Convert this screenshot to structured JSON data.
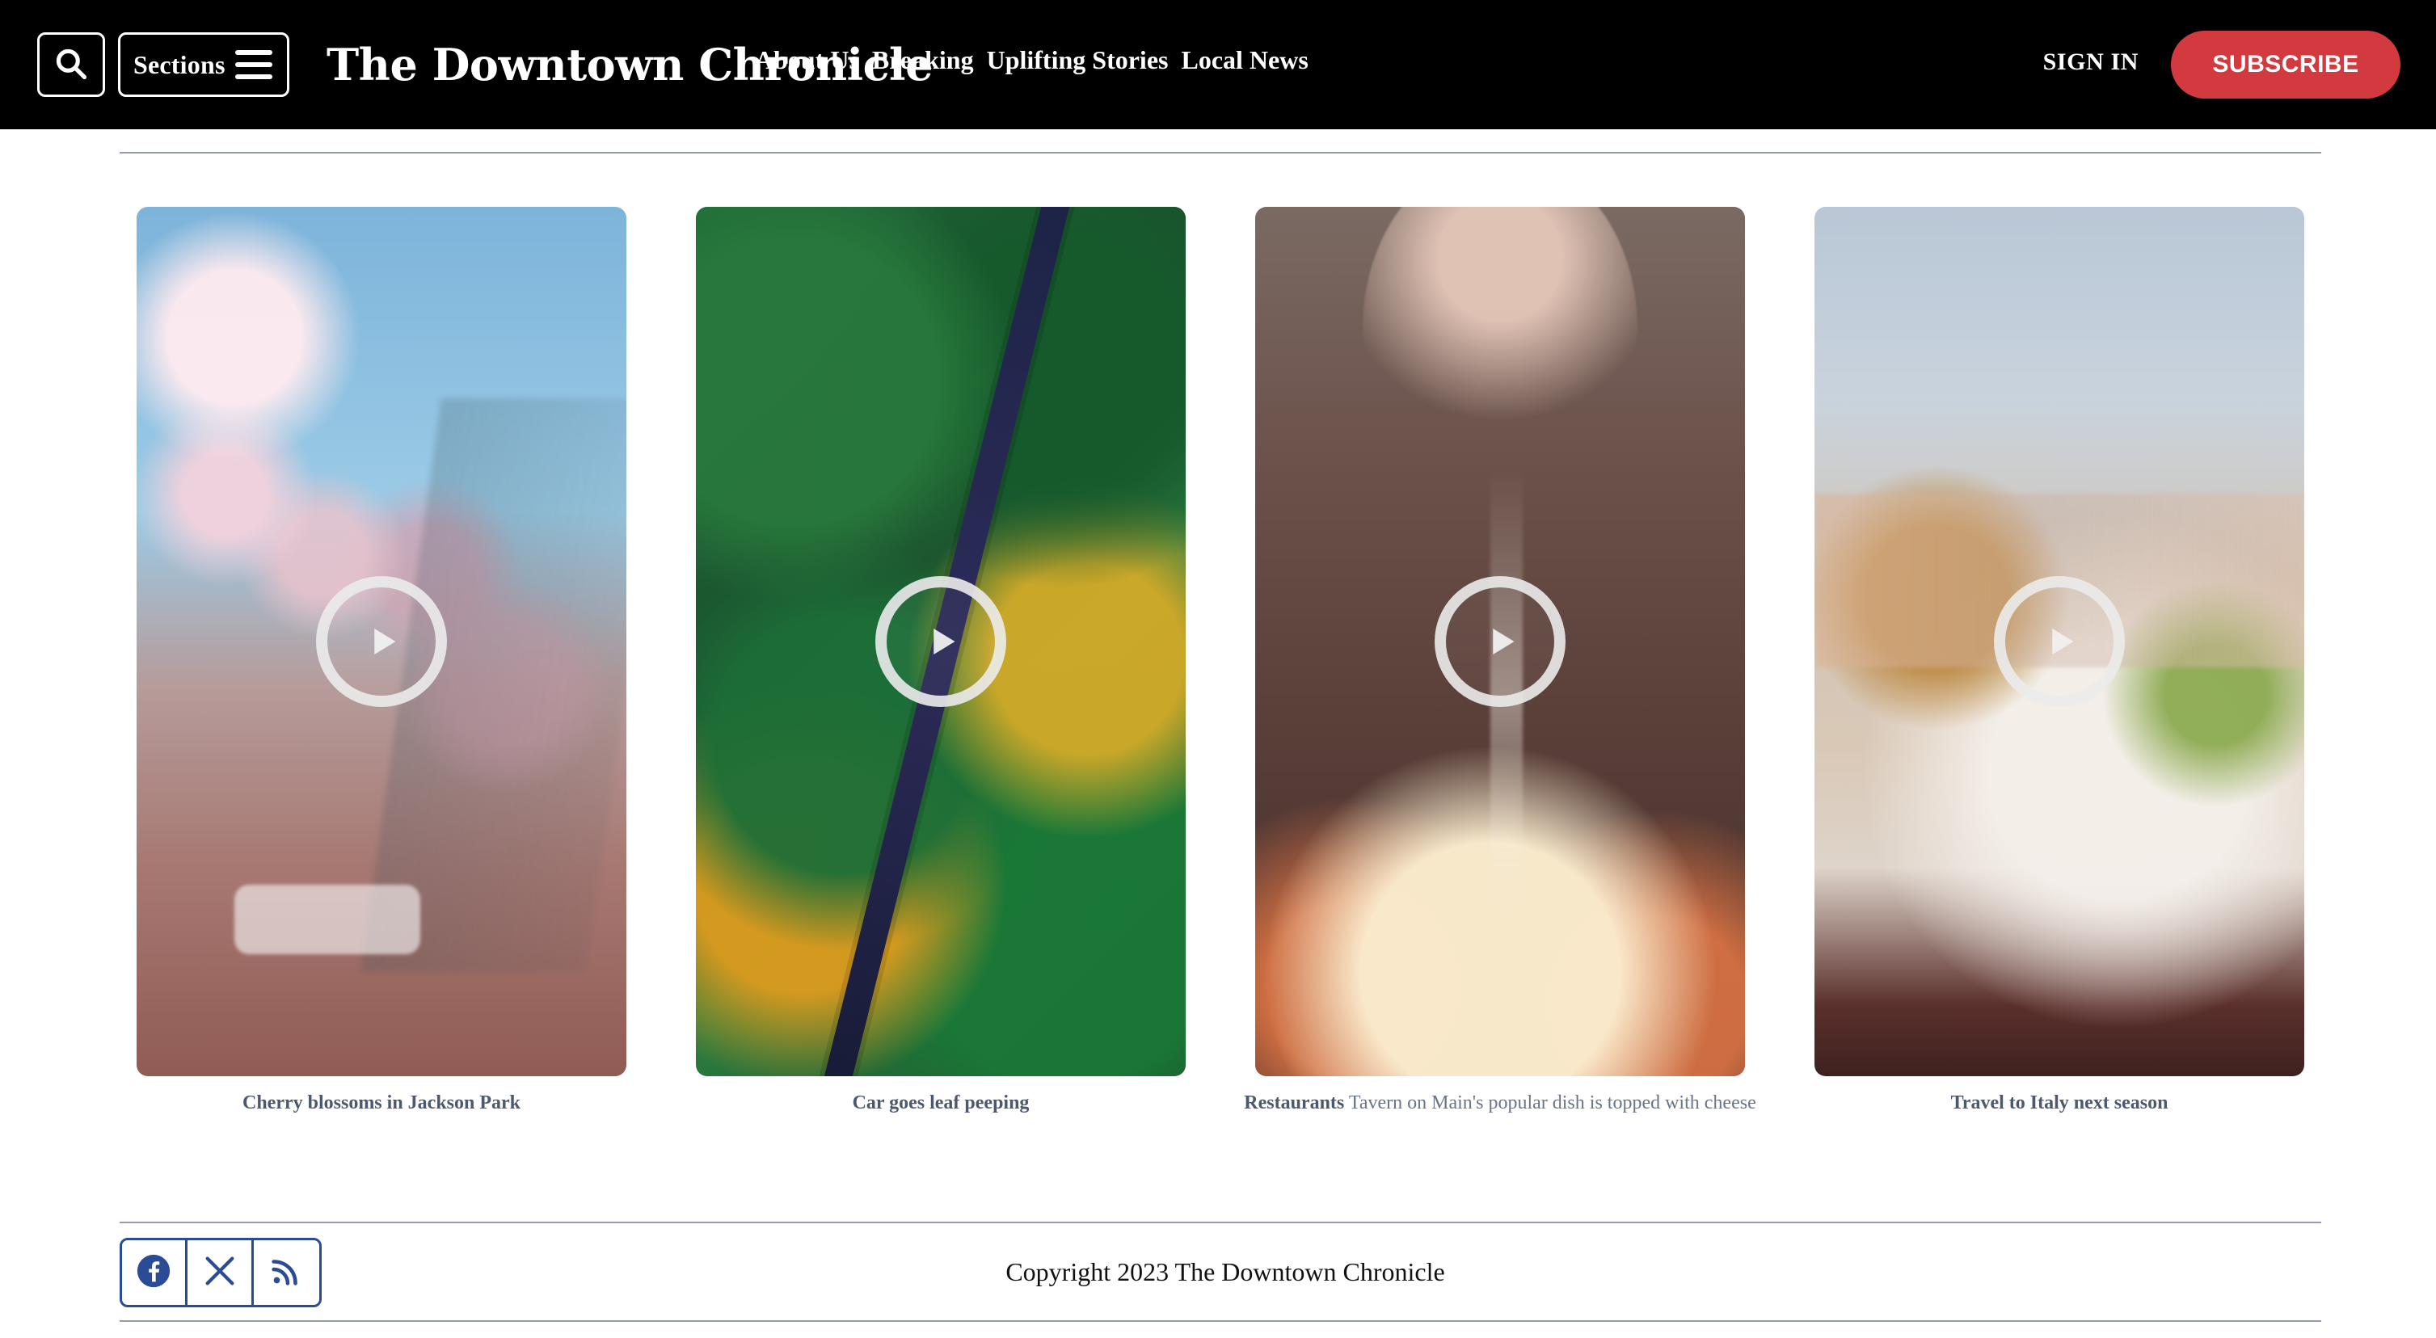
{
  "header": {
    "search_icon": "search-icon",
    "sections_label": "Sections",
    "menu_icon": "hamburger-icon",
    "logo_text": "The Downtown Chronicle",
    "nav": [
      {
        "label": "About Us"
      },
      {
        "label": "Breaking"
      },
      {
        "label": "Uplifting Stories"
      },
      {
        "label": "Local News"
      }
    ],
    "signin_label": "SIGN IN",
    "subscribe_label": "SUBSCRIBE",
    "accent_color": "#d33a3f"
  },
  "videos": [
    {
      "caption": "Cherry blossoms in Jackson Park",
      "play_icon": "play-icon"
    },
    {
      "caption": "Car goes leaf peeping",
      "play_icon": "play-icon"
    },
    {
      "caption_prefix": "Restaurants",
      "caption": "Tavern on Main's popular dish is topped with cheese",
      "play_icon": "play-icon"
    },
    {
      "caption": "Travel to Italy next season",
      "play_icon": "play-icon"
    }
  ],
  "footer": {
    "social": [
      {
        "icon": "facebook-icon"
      },
      {
        "icon": "x-icon"
      },
      {
        "icon": "rss-icon"
      }
    ],
    "copyright": "Copyright 2023 The Downtown Chronicle",
    "social_color": "#2a4c96"
  }
}
